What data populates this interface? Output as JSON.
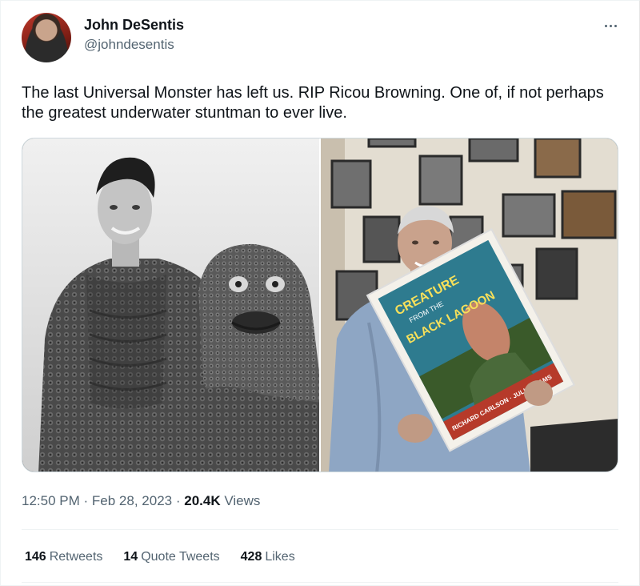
{
  "author": {
    "display_name": "John DeSentis",
    "handle": "@johndesentis"
  },
  "more_icon": "more-horizontal-icon",
  "tweet": {
    "text": "The last Universal Monster has left us. RIP Ricou Browning. One of, if not perhaps the greatest underwater stuntman to ever live."
  },
  "media": {
    "poster_text": {
      "title_line1": "CREATURE",
      "title_line2": "FROM THE",
      "title_line3": "BLACK LAGOON",
      "credits": "RICHARD CARLSON · JULIA ADAMS"
    }
  },
  "meta": {
    "time": "12:50 PM",
    "separator": "·",
    "date": "Feb 28, 2023",
    "views_count": "20.4K",
    "views_label": "Views"
  },
  "stats": {
    "retweets_count": "146",
    "retweets_label": "Retweets",
    "quotes_count": "14",
    "quotes_label": "Quote Tweets",
    "likes_count": "428",
    "likes_label": "Likes"
  },
  "colors": {
    "text_primary": "#0f1419",
    "text_secondary": "#536471",
    "divider": "#eff3f4"
  }
}
